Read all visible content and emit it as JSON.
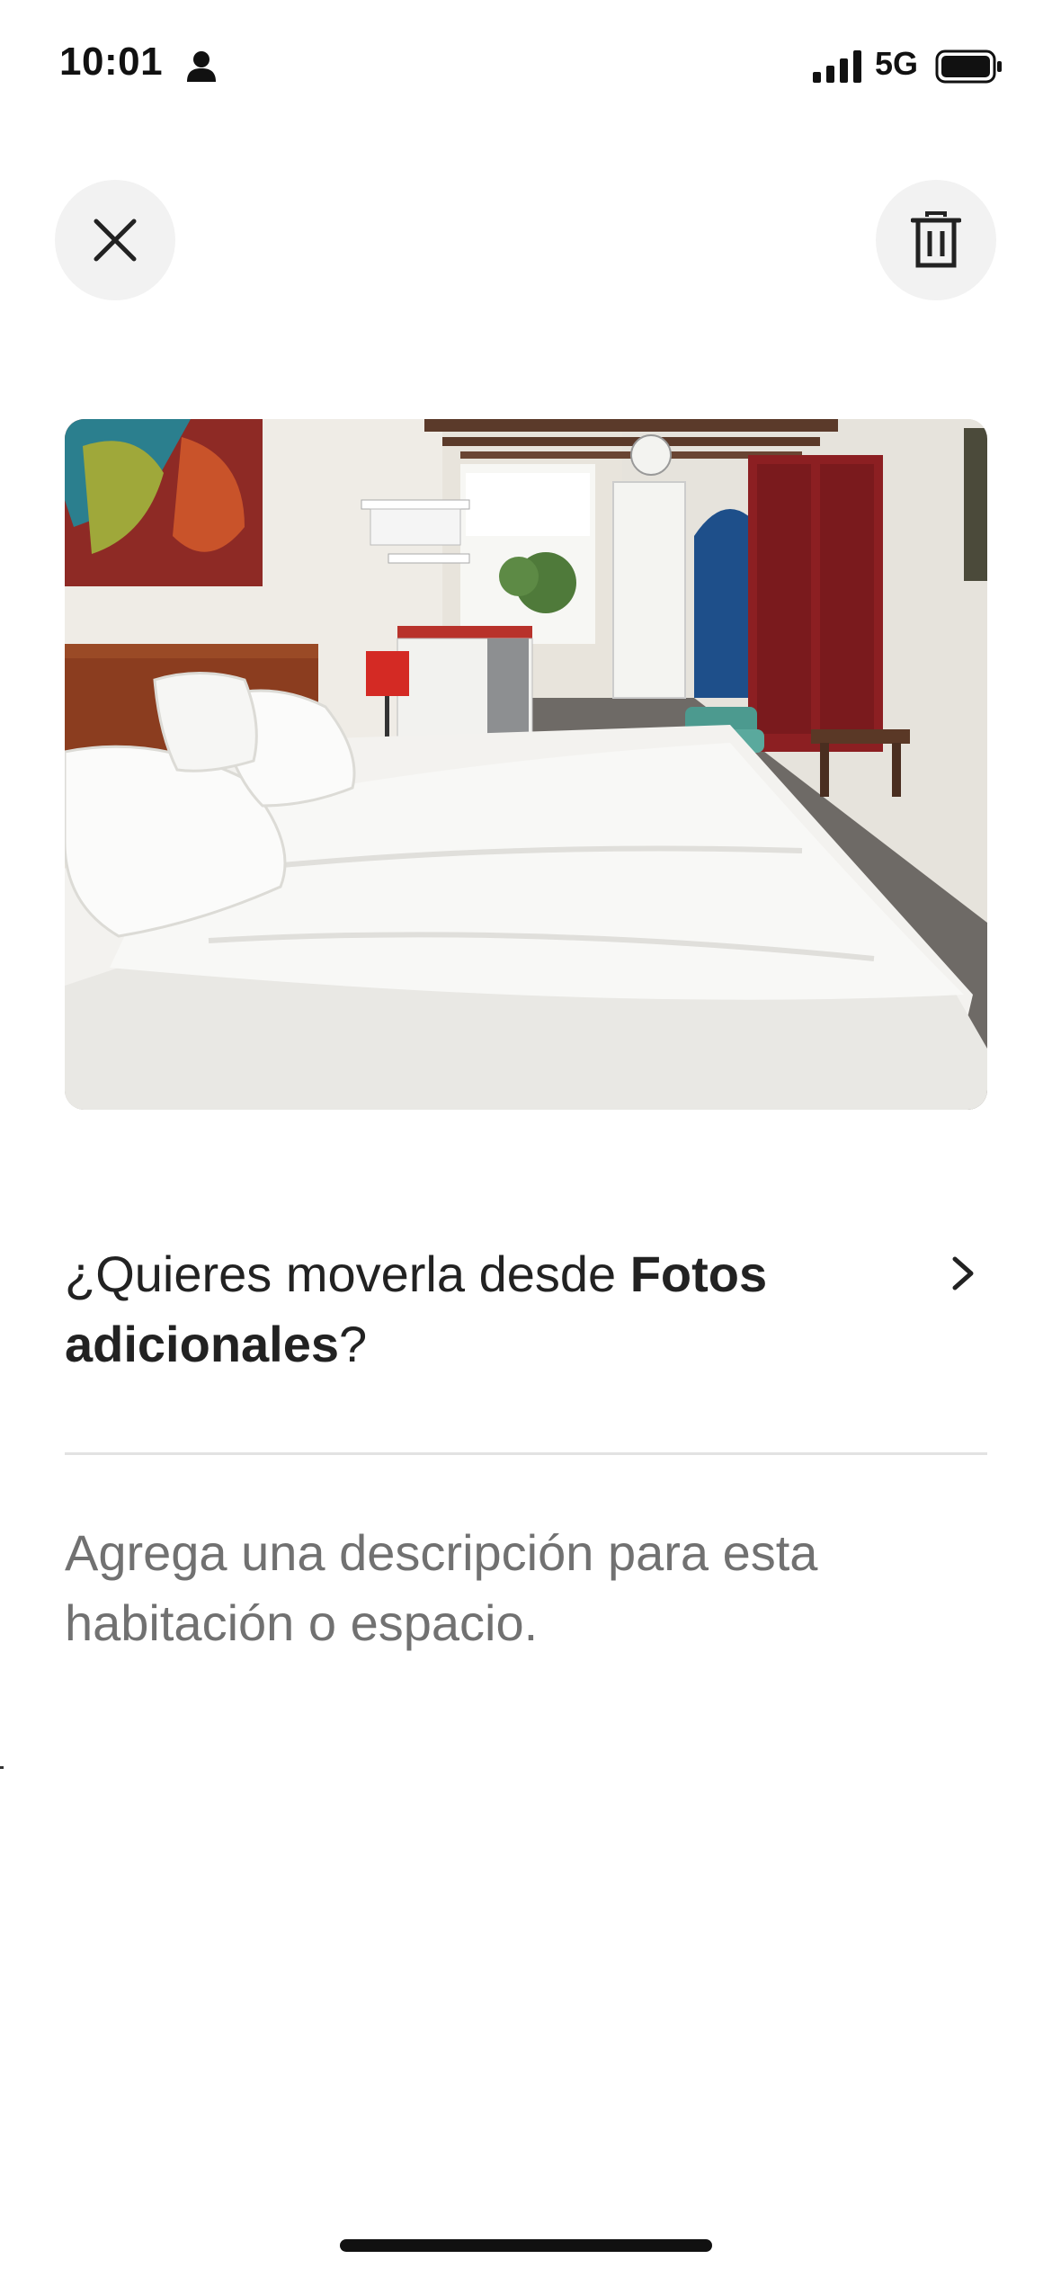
{
  "status_bar": {
    "time": "10:01",
    "network": "5G",
    "icons": [
      "person-icon",
      "signal-icon",
      "battery-icon"
    ]
  },
  "header": {
    "close_icon": "close-icon",
    "trash_icon": "trash-icon"
  },
  "photo": {
    "subject": "bedroom-photo"
  },
  "move": {
    "prefix": "¿Quieres moverla desde ",
    "album": "Fotos adicionales",
    "suffix": "?",
    "icon": "chevron-right-icon"
  },
  "description": {
    "placeholder": "Agrega una descripción para esta habitación o espacio."
  },
  "colors": {
    "text": "#222222",
    "muted": "#717171",
    "button_bg": "#f2f2f2",
    "divider": "#e2e2e2"
  }
}
